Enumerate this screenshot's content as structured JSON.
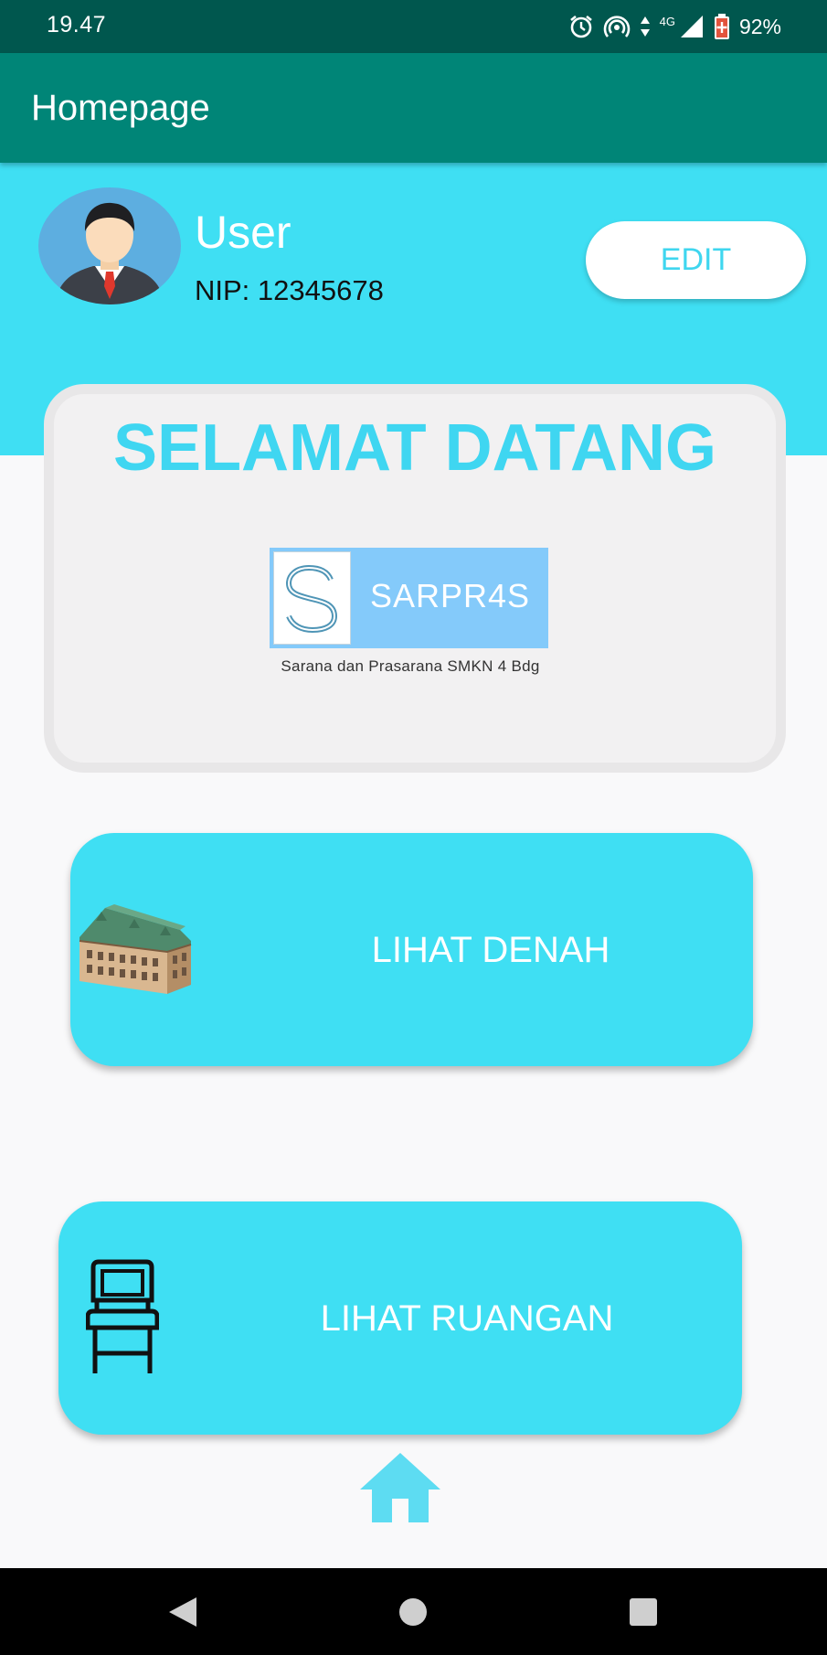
{
  "status_bar": {
    "time": "19.47",
    "network": "4G",
    "battery": "92%"
  },
  "app_bar": {
    "title": "Homepage"
  },
  "profile": {
    "name": "User",
    "nip": "NIP: 12345678",
    "edit_label": "EDIT"
  },
  "welcome": {
    "title": "SELAMAT DATANG",
    "logo_text": "SARPR4S",
    "logo_subtitle": "Sarana dan Prasarana SMKN 4 Bdg"
  },
  "menu": {
    "denah_label": "LIHAT DENAH",
    "ruangan_label": "LIHAT RUANGAN"
  },
  "colors": {
    "status_bar": "#00574e",
    "app_bar": "#008577",
    "accent": "#3fdff3",
    "card_bg": "#f2f1f2"
  },
  "icons": {
    "avatar": "businessman-avatar",
    "denah": "building-icon",
    "ruangan": "chair-icon",
    "bottom": "home-icon"
  }
}
